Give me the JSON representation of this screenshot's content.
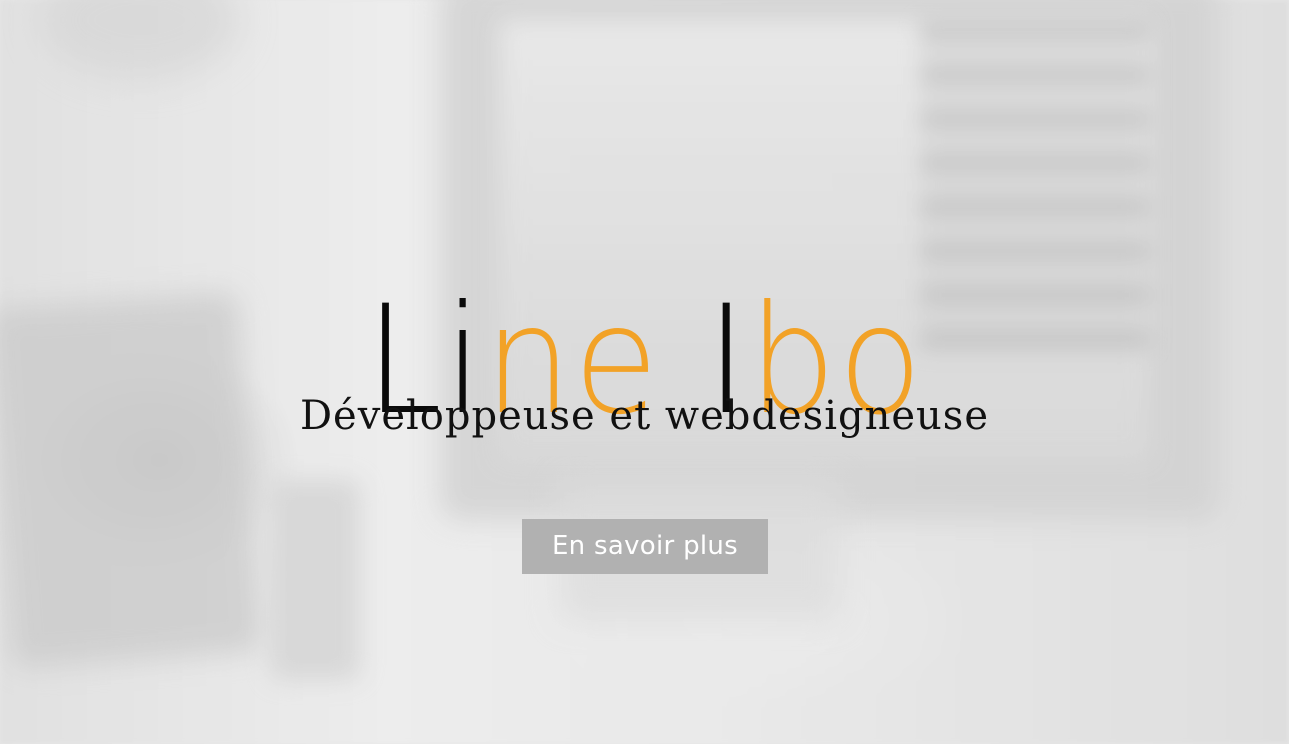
{
  "hero": {
    "title_parts": [
      "Li",
      "ne",
      " I",
      "bo"
    ],
    "subtitle": "Développeuse et webdesigneuse",
    "cta_label": "En savoir plus"
  },
  "colors": {
    "accent": "#f2a227",
    "title": "#0a0a0a",
    "button_bg": "#b1b1b1",
    "button_text": "#ffffff"
  }
}
